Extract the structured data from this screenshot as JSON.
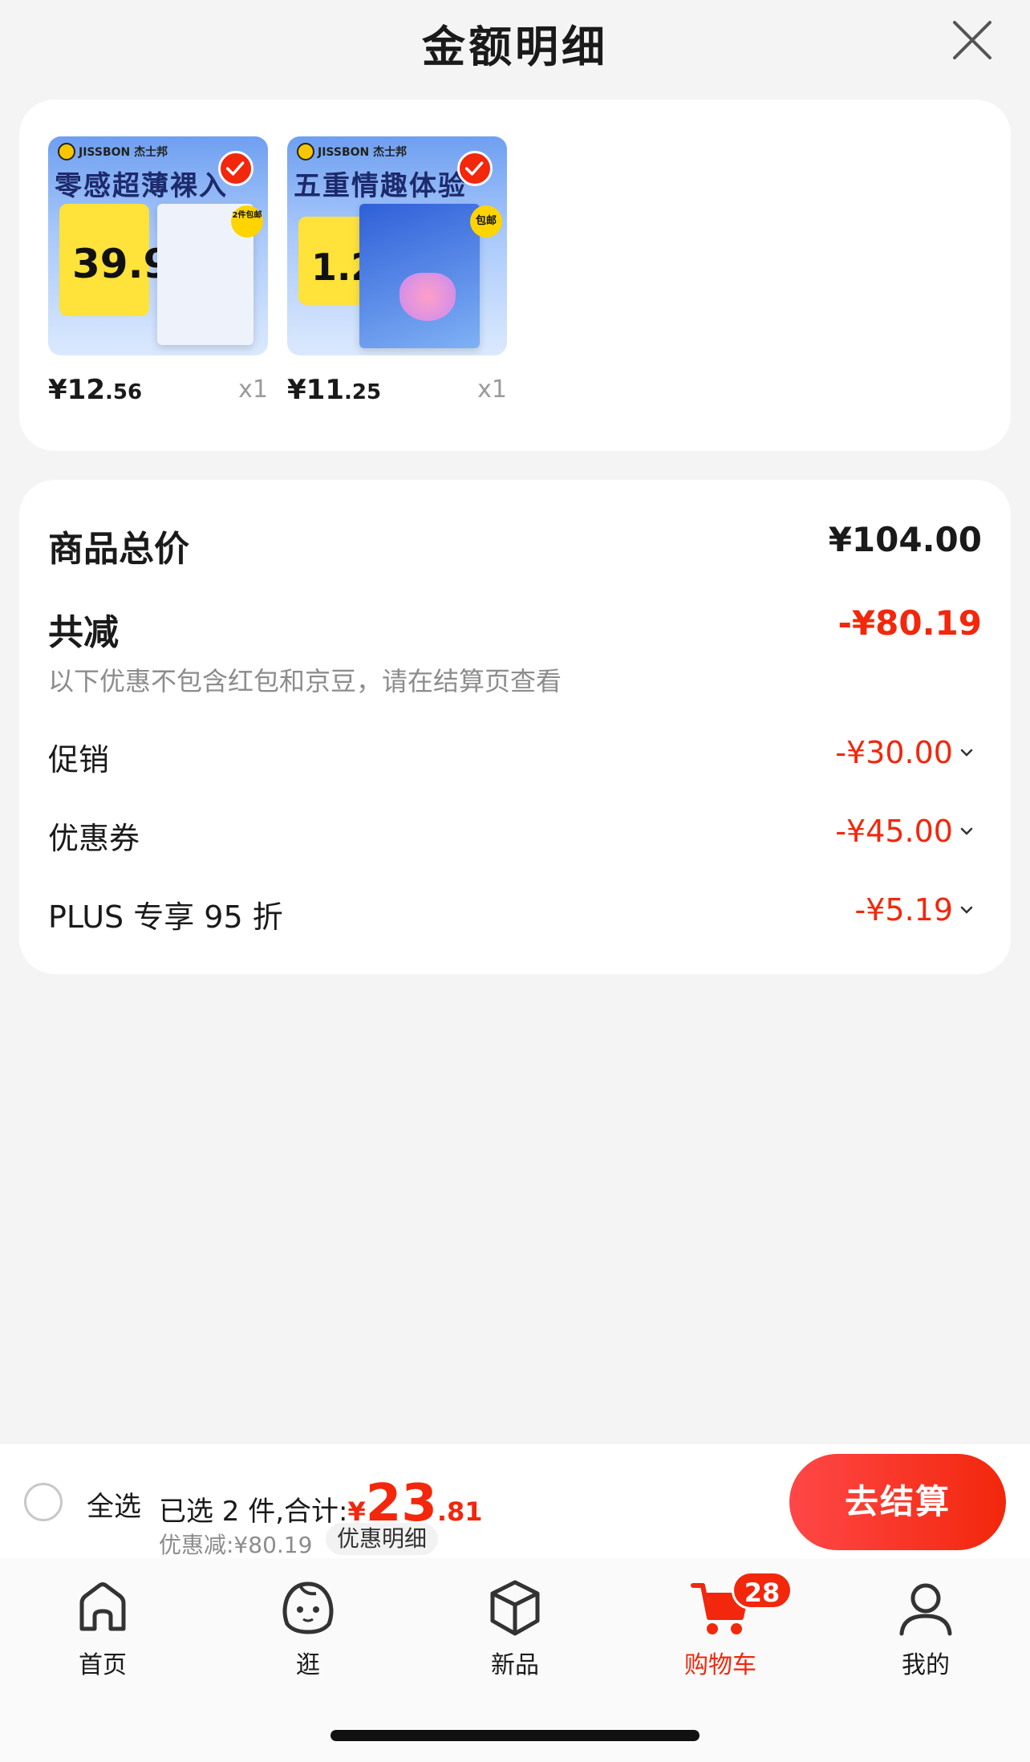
{
  "header": {
    "title": "金额明细",
    "close_icon": "close-icon"
  },
  "products": [
    {
      "brand": "JISSBON 杰士邦",
      "headline": "零感超薄裸入",
      "promo_price": "39.9",
      "badge": "2件包邮",
      "price_main": "¥12",
      "price_cents": ".56",
      "qty": "x1"
    },
    {
      "brand": "JISSBON 杰士邦",
      "headline": "五重情趣体验",
      "promo_price": "1.2",
      "badge": "包邮",
      "price_main": "¥11",
      "price_cents": ".25",
      "qty": "x1"
    }
  ],
  "summary": {
    "total_label": "商品总价",
    "total_value": "¥104.00",
    "reduce_label": "共减",
    "reduce_value": "-¥80.19",
    "note": "以下优惠不包含红包和京豆，请在结算页查看",
    "items": [
      {
        "label": "促销",
        "value": "-¥30.00"
      },
      {
        "label": "优惠券",
        "value": "-¥45.00"
      },
      {
        "label": "PLUS 专享 95 折",
        "value": "-¥5.19"
      }
    ]
  },
  "bottom_bar": {
    "select_all": "全选",
    "selected_text": "已选 2 件,合计:",
    "sum_currency": "¥",
    "sum_int": "23",
    "sum_dec": ".81",
    "discount_text": "优惠减:¥80.19",
    "detail_link": "优惠明细",
    "checkout": "去结算"
  },
  "tabbar": {
    "tabs": [
      {
        "label": "首页",
        "icon": "home-icon"
      },
      {
        "label": "逛",
        "icon": "face-icon"
      },
      {
        "label": "新品",
        "icon": "cube-icon"
      },
      {
        "label": "购物车",
        "icon": "cart-icon",
        "badge": "28",
        "active": true
      },
      {
        "label": "我的",
        "icon": "user-icon"
      }
    ]
  },
  "colors": {
    "accent": "#f2270c",
    "muted": "#8c8c8c",
    "background": "#f4f4f4"
  }
}
